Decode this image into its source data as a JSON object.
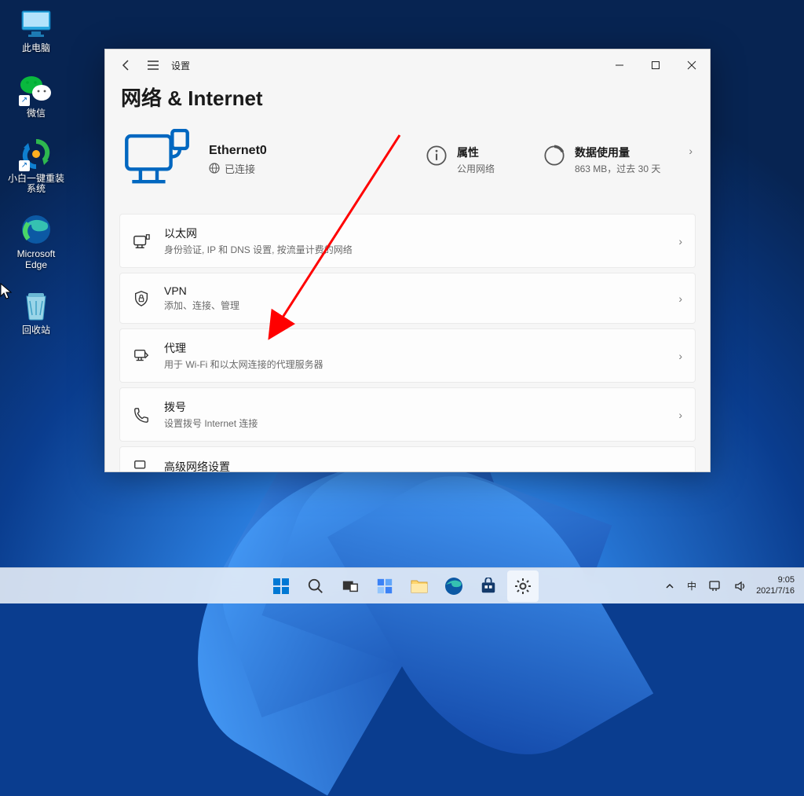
{
  "desktop": {
    "icons": [
      {
        "id": "this-pc",
        "label": "此电脑"
      },
      {
        "id": "wechat",
        "label": "微信"
      },
      {
        "id": "xiaobai",
        "label": "小白一键重装\n系统"
      },
      {
        "id": "edge",
        "label": "Microsoft\nEdge"
      },
      {
        "id": "recyclebin",
        "label": "回收站"
      }
    ]
  },
  "window": {
    "app_title": "设置",
    "page_title": "网络 & Internet",
    "ethernet": {
      "name": "Ethernet0",
      "status": "已连接"
    },
    "info": {
      "props_title": "属性",
      "props_sub": "公用网络",
      "data_title": "数据使用量",
      "data_sub": "863 MB，过去 30 天"
    },
    "items": [
      {
        "id": "ethernet",
        "title": "以太网",
        "sub": "身份验证, IP 和 DNS 设置, 按流量计费的网络"
      },
      {
        "id": "vpn",
        "title": "VPN",
        "sub": "添加、连接、管理"
      },
      {
        "id": "proxy",
        "title": "代理",
        "sub": "用于 Wi-Fi 和以太网连接的代理服务器"
      },
      {
        "id": "dialup",
        "title": "拨号",
        "sub": "设置拨号 Internet 连接"
      },
      {
        "id": "advanced",
        "title": "高级网络设置",
        "sub": ""
      }
    ]
  },
  "taskbar": {
    "ime": "中",
    "time": "9:05",
    "date": "2021/7/16"
  }
}
